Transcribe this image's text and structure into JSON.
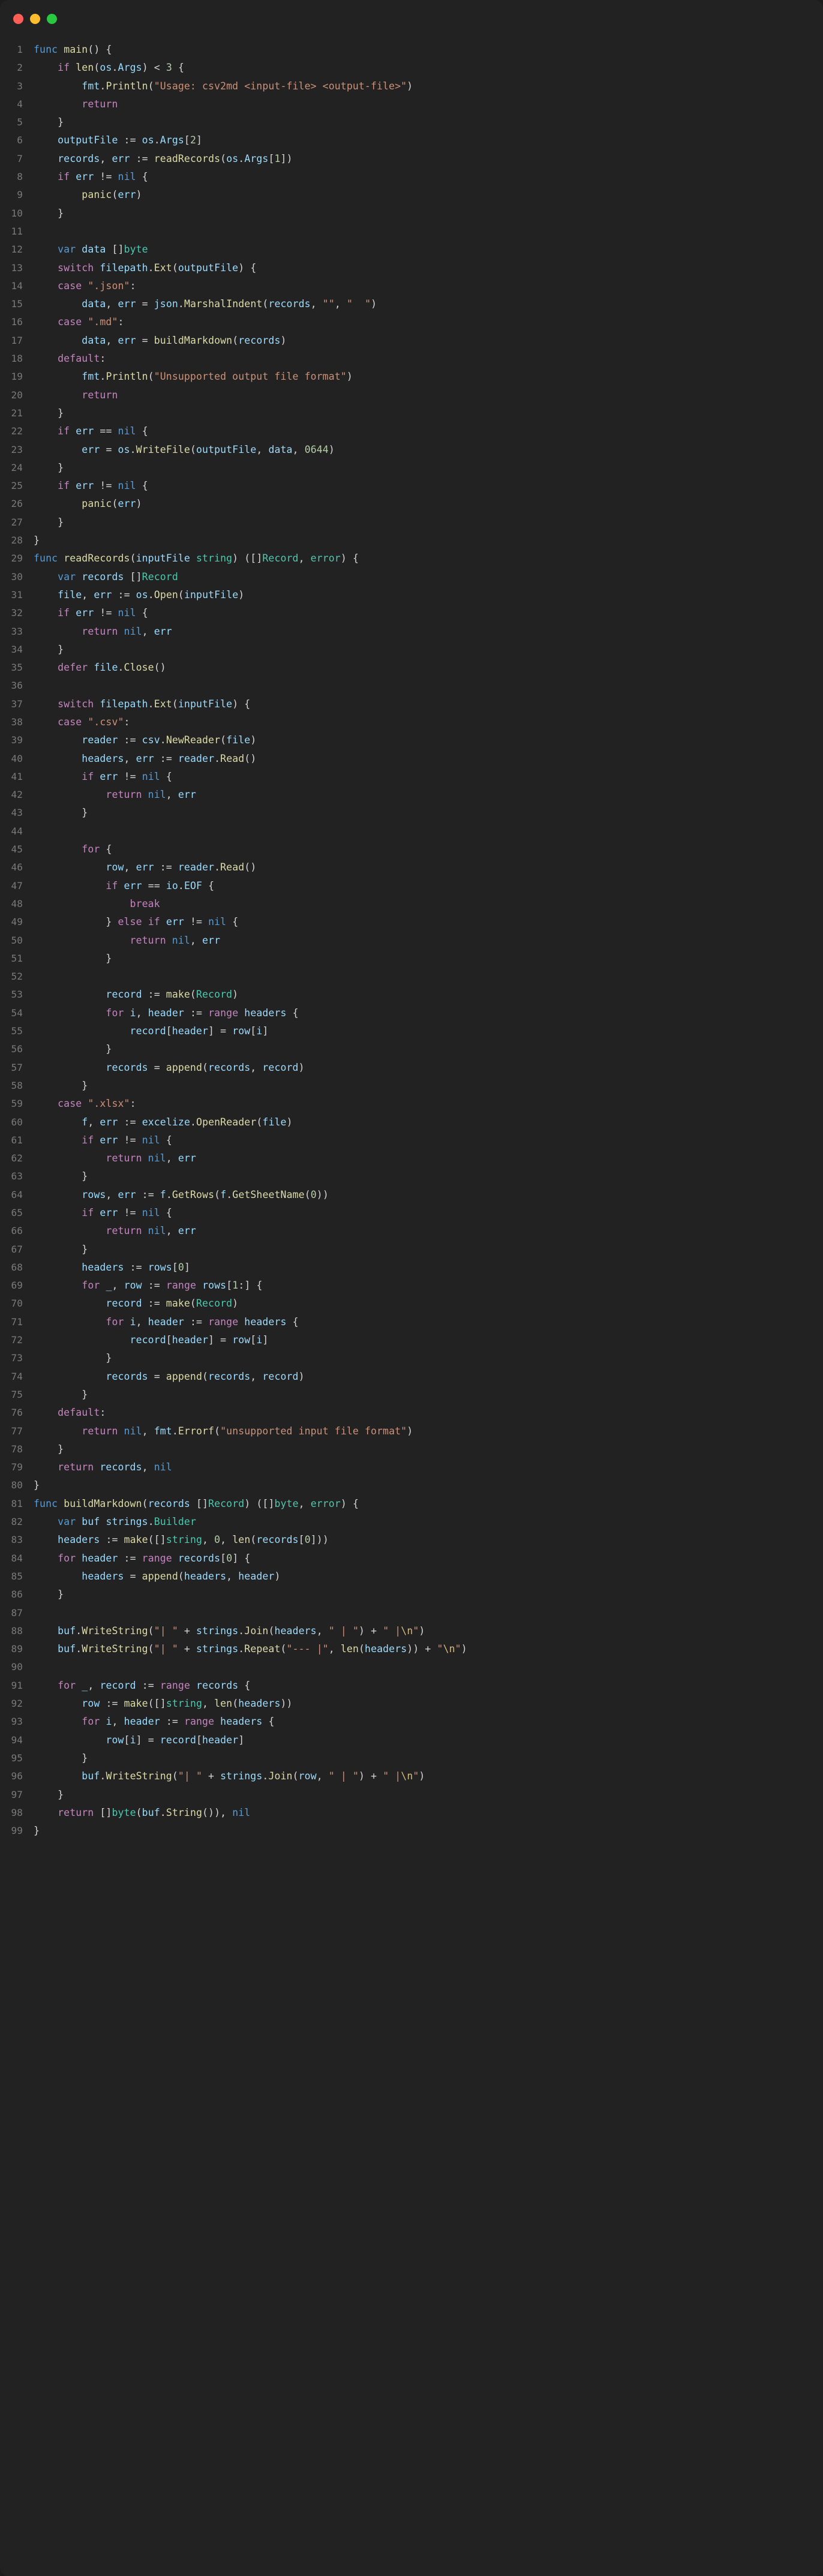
{
  "window": {
    "background_color": "#222222",
    "traffic_lights": [
      {
        "name": "close",
        "color": "#ff5f57"
      },
      {
        "name": "minimize",
        "color": "#febc2e"
      },
      {
        "name": "maximize",
        "color": "#28c840"
      }
    ]
  },
  "editor": {
    "language": "go",
    "theme_colors": {
      "background": "#222222",
      "line_number": "#7a7a7a",
      "default_text": "#d4d4d4",
      "control_keyword": "#c586c0",
      "declaration_keyword": "#569cd6",
      "type": "#4ec9b0",
      "function": "#dcdcaa",
      "variable": "#9cdcfe",
      "string": "#ce9178",
      "escape": "#d7ba7d",
      "number": "#b5cea8"
    },
    "first_line_number": 1,
    "last_line_number": 99,
    "total_lines": 99,
    "lines": [
      {
        "n": 1,
        "text": "func main() {"
      },
      {
        "n": 2,
        "text": "    if len(os.Args) < 3 {"
      },
      {
        "n": 3,
        "text": "        fmt.Println(\"Usage: csv2md <input-file> <output-file>\")"
      },
      {
        "n": 4,
        "text": "        return"
      },
      {
        "n": 5,
        "text": "    }"
      },
      {
        "n": 6,
        "text": "    outputFile := os.Args[2]"
      },
      {
        "n": 7,
        "text": "    records, err := readRecords(os.Args[1])"
      },
      {
        "n": 8,
        "text": "    if err != nil {"
      },
      {
        "n": 9,
        "text": "        panic(err)"
      },
      {
        "n": 10,
        "text": "    }"
      },
      {
        "n": 11,
        "text": ""
      },
      {
        "n": 12,
        "text": "    var data []byte"
      },
      {
        "n": 13,
        "text": "    switch filepath.Ext(outputFile) {"
      },
      {
        "n": 14,
        "text": "    case \".json\":"
      },
      {
        "n": 15,
        "text": "        data, err = json.MarshalIndent(records, \"\", \"  \")"
      },
      {
        "n": 16,
        "text": "    case \".md\":"
      },
      {
        "n": 17,
        "text": "        data, err = buildMarkdown(records)"
      },
      {
        "n": 18,
        "text": "    default:"
      },
      {
        "n": 19,
        "text": "        fmt.Println(\"Unsupported output file format\")"
      },
      {
        "n": 20,
        "text": "        return"
      },
      {
        "n": 21,
        "text": "    }"
      },
      {
        "n": 22,
        "text": "    if err == nil {"
      },
      {
        "n": 23,
        "text": "        err = os.WriteFile(outputFile, data, 0644)"
      },
      {
        "n": 24,
        "text": "    }"
      },
      {
        "n": 25,
        "text": "    if err != nil {"
      },
      {
        "n": 26,
        "text": "        panic(err)"
      },
      {
        "n": 27,
        "text": "    }"
      },
      {
        "n": 28,
        "text": "}"
      },
      {
        "n": 29,
        "text": "func readRecords(inputFile string) ([]Record, error) {"
      },
      {
        "n": 30,
        "text": "    var records []Record"
      },
      {
        "n": 31,
        "text": "    file, err := os.Open(inputFile)"
      },
      {
        "n": 32,
        "text": "    if err != nil {"
      },
      {
        "n": 33,
        "text": "        return nil, err"
      },
      {
        "n": 34,
        "text": "    }"
      },
      {
        "n": 35,
        "text": "    defer file.Close()"
      },
      {
        "n": 36,
        "text": ""
      },
      {
        "n": 37,
        "text": "    switch filepath.Ext(inputFile) {"
      },
      {
        "n": 38,
        "text": "    case \".csv\":"
      },
      {
        "n": 39,
        "text": "        reader := csv.NewReader(file)"
      },
      {
        "n": 40,
        "text": "        headers, err := reader.Read()"
      },
      {
        "n": 41,
        "text": "        if err != nil {"
      },
      {
        "n": 42,
        "text": "            return nil, err"
      },
      {
        "n": 43,
        "text": "        }"
      },
      {
        "n": 44,
        "text": ""
      },
      {
        "n": 45,
        "text": "        for {"
      },
      {
        "n": 46,
        "text": "            row, err := reader.Read()"
      },
      {
        "n": 47,
        "text": "            if err == io.EOF {"
      },
      {
        "n": 48,
        "text": "                break"
      },
      {
        "n": 49,
        "text": "            } else if err != nil {"
      },
      {
        "n": 50,
        "text": "                return nil, err"
      },
      {
        "n": 51,
        "text": "            }"
      },
      {
        "n": 52,
        "text": ""
      },
      {
        "n": 53,
        "text": "            record := make(Record)"
      },
      {
        "n": 54,
        "text": "            for i, header := range headers {"
      },
      {
        "n": 55,
        "text": "                record[header] = row[i]"
      },
      {
        "n": 56,
        "text": "            }"
      },
      {
        "n": 57,
        "text": "            records = append(records, record)"
      },
      {
        "n": 58,
        "text": "        }"
      },
      {
        "n": 59,
        "text": "    case \".xlsx\":"
      },
      {
        "n": 60,
        "text": "        f, err := excelize.OpenReader(file)"
      },
      {
        "n": 61,
        "text": "        if err != nil {"
      },
      {
        "n": 62,
        "text": "            return nil, err"
      },
      {
        "n": 63,
        "text": "        }"
      },
      {
        "n": 64,
        "text": "        rows, err := f.GetRows(f.GetSheetName(0))"
      },
      {
        "n": 65,
        "text": "        if err != nil {"
      },
      {
        "n": 66,
        "text": "            return nil, err"
      },
      {
        "n": 67,
        "text": "        }"
      },
      {
        "n": 68,
        "text": "        headers := rows[0]"
      },
      {
        "n": 69,
        "text": "        for _, row := range rows[1:] {"
      },
      {
        "n": 70,
        "text": "            record := make(Record)"
      },
      {
        "n": 71,
        "text": "            for i, header := range headers {"
      },
      {
        "n": 72,
        "text": "                record[header] = row[i]"
      },
      {
        "n": 73,
        "text": "            }"
      },
      {
        "n": 74,
        "text": "            records = append(records, record)"
      },
      {
        "n": 75,
        "text": "        }"
      },
      {
        "n": 76,
        "text": "    default:"
      },
      {
        "n": 77,
        "text": "        return nil, fmt.Errorf(\"unsupported input file format\")"
      },
      {
        "n": 78,
        "text": "    }"
      },
      {
        "n": 79,
        "text": "    return records, nil"
      },
      {
        "n": 80,
        "text": "}"
      },
      {
        "n": 81,
        "text": "func buildMarkdown(records []Record) ([]byte, error) {"
      },
      {
        "n": 82,
        "text": "    var buf strings.Builder"
      },
      {
        "n": 83,
        "text": "    headers := make([]string, 0, len(records[0]))"
      },
      {
        "n": 84,
        "text": "    for header := range records[0] {"
      },
      {
        "n": 85,
        "text": "        headers = append(headers, header)"
      },
      {
        "n": 86,
        "text": "    }"
      },
      {
        "n": 87,
        "text": ""
      },
      {
        "n": 88,
        "text": "    buf.WriteString(\"| \" + strings.Join(headers, \" | \") + \" |\\n\")"
      },
      {
        "n": 89,
        "text": "    buf.WriteString(\"| \" + strings.Repeat(\"--- |\", len(headers)) + \"\\n\")"
      },
      {
        "n": 90,
        "text": ""
      },
      {
        "n": 91,
        "text": "    for _, record := range records {"
      },
      {
        "n": 92,
        "text": "        row := make([]string, len(headers))"
      },
      {
        "n": 93,
        "text": "        for i, header := range headers {"
      },
      {
        "n": 94,
        "text": "            row[i] = record[header]"
      },
      {
        "n": 95,
        "text": "        }"
      },
      {
        "n": 96,
        "text": "        buf.WriteString(\"| \" + strings.Join(row, \" | \") + \" |\\n\")"
      },
      {
        "n": 97,
        "text": "    }"
      },
      {
        "n": 98,
        "text": "    return []byte(buf.String()), nil"
      },
      {
        "n": 99,
        "text": "}"
      }
    ]
  }
}
